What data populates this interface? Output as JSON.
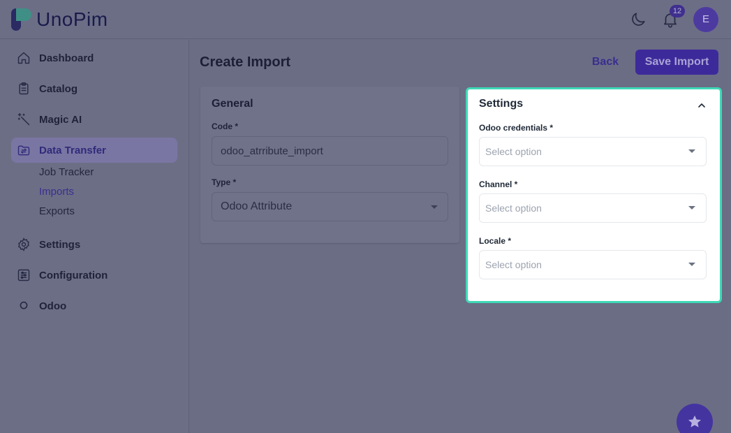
{
  "brand": {
    "name": "UnoPim"
  },
  "header": {
    "notification_count": "12",
    "avatar_initial": "E"
  },
  "sidebar": {
    "items": [
      {
        "label": "Dashboard",
        "icon": "home-icon"
      },
      {
        "label": "Catalog",
        "icon": "clipboard-icon"
      },
      {
        "label": "Magic AI",
        "icon": "magic-wand-icon"
      },
      {
        "label": "Data Transfer",
        "icon": "transfer-icon",
        "active": true,
        "children": [
          {
            "label": "Job Tracker"
          },
          {
            "label": "Imports",
            "active": true
          },
          {
            "label": "Exports"
          }
        ]
      },
      {
        "label": "Settings",
        "icon": "gear-icon"
      },
      {
        "label": "Configuration",
        "icon": "sliders-icon"
      },
      {
        "label": "Odoo",
        "icon": "circle-icon"
      }
    ]
  },
  "page": {
    "title": "Create Import",
    "back_label": "Back",
    "save_label": "Save Import"
  },
  "general": {
    "title": "General",
    "code_label": "Code *",
    "code_value": "odoo_atrribute_import",
    "type_label": "Type *",
    "type_value": "Odoo Attribute"
  },
  "settings": {
    "title": "Settings",
    "fields": [
      {
        "label": "Odoo credentials *",
        "placeholder": "Select option"
      },
      {
        "label": "Channel *",
        "placeholder": "Select option"
      },
      {
        "label": "Locale *",
        "placeholder": "Select option"
      }
    ]
  },
  "colors": {
    "accent": "#4a36b5",
    "highlight": "#3ed9b7",
    "overlay": "#6b6d85"
  }
}
